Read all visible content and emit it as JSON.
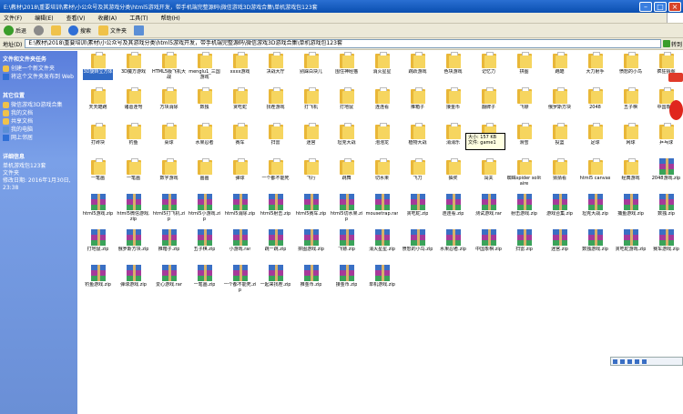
{
  "window": {
    "title": "E:\\教材\\2018\\重要培训\\素材\\小公众号及其游戏分类\\html5游戏开发，带手机端完整源码\\微信游戏3D游戏合集\\单机游戏包123套"
  },
  "menu": [
    "文件(F)",
    "编辑(E)",
    "查看(V)",
    "收藏(A)",
    "工具(T)",
    "帮助(H)"
  ],
  "toolbar": {
    "back": "后退",
    "forward": "",
    "search": "搜索",
    "folders": "文件夹",
    "views": ""
  },
  "address": {
    "label": "地址(D)",
    "value": "E:\\教材\\2018\\重要培训\\素材\\小公众号及其游戏分类\\html5游戏开发，带手机端完整源码\\微信游戏3D游戏合集\\单机游戏包123套",
    "go": "转到"
  },
  "leftpanel": {
    "tasks_title": "文件和文件夹任务",
    "tasks": [
      "创建一个新文件夹",
      "将这个文件夹发布到 Web"
    ],
    "places_title": "其它位置",
    "places": [
      "微信游戏3D游戏合集",
      "我的文档",
      "共享文档",
      "我的电脑",
      "网上邻居"
    ],
    "details_title": "详细信息",
    "details_name": "单机游戏包123套",
    "details_type": "文件夹",
    "details_date": "修改日期: 2016年1月30日, 23:38"
  },
  "tooltip": {
    "size": "大小: 157 KB",
    "files": "文件: game1"
  },
  "items": [
    {
      "type": "folder",
      "label": "3D旋转立方体"
    },
    {
      "type": "folder",
      "label": "3D魔方游戏"
    },
    {
      "type": "folder",
      "label": "HTML5版飞机大战"
    },
    {
      "type": "folder",
      "label": "menglu1_三国游戏"
    },
    {
      "type": "folder",
      "label": "xxxx游戏"
    },
    {
      "type": "folder",
      "label": "决战大厅"
    },
    {
      "type": "folder",
      "label": "别踩白块儿"
    },
    {
      "type": "folder",
      "label": "围住神经猫"
    },
    {
      "type": "folder",
      "label": "消灭星星"
    },
    {
      "type": "folder",
      "label": "跳跃游戏"
    },
    {
      "type": "folder",
      "label": "色块游戏"
    },
    {
      "type": "folder",
      "label": "记忆力"
    },
    {
      "type": "folder",
      "label": "拼图"
    },
    {
      "type": "folder",
      "label": "跑酷"
    },
    {
      "type": "folder",
      "label": "大力射手"
    },
    {
      "type": "folder",
      "label": "愤怒的小鸟"
    },
    {
      "type": "folder",
      "label": "疯狂猜图"
    },
    {
      "type": "folder",
      "label": "天天酷跑"
    },
    {
      "type": "folder",
      "label": "诸葛连弩"
    },
    {
      "type": "folder",
      "label": "方块消除"
    },
    {
      "type": "folder",
      "label": "数独"
    },
    {
      "type": "folder",
      "label": "贪吃蛇"
    },
    {
      "type": "folder",
      "label": "找茬游戏"
    },
    {
      "type": "folder",
      "label": "打飞机"
    },
    {
      "type": "folder",
      "label": "打地鼠"
    },
    {
      "type": "folder",
      "label": "连连看"
    },
    {
      "type": "folder",
      "label": "推箱子"
    },
    {
      "type": "folder",
      "label": "接金币"
    },
    {
      "type": "folder",
      "label": "翻牌子"
    },
    {
      "type": "folder",
      "label": "飞镖"
    },
    {
      "type": "folder",
      "label": "俄罗斯方块"
    },
    {
      "type": "folder",
      "label": "2048"
    },
    {
      "type": "folder",
      "label": "五子棋"
    },
    {
      "type": "folder",
      "label": "中国象棋"
    },
    {
      "type": "folder",
      "label": "打砖块"
    },
    {
      "type": "folder",
      "label": "钓鱼"
    },
    {
      "type": "folder",
      "label": "桌球"
    },
    {
      "type": "folder",
      "label": "水果忍者"
    },
    {
      "type": "folder",
      "label": "赛车"
    },
    {
      "type": "folder",
      "label": "扫雷"
    },
    {
      "type": "folder",
      "label": "迷宫"
    },
    {
      "type": "folder",
      "label": "坦克大战"
    },
    {
      "type": "folder",
      "label": "泡泡龙"
    },
    {
      "type": "folder",
      "label": "植物大战"
    },
    {
      "type": "folder",
      "label": "消消乐"
    },
    {
      "type": "folder",
      "label": "射击"
    },
    {
      "type": "folder",
      "label": "滑雪"
    },
    {
      "type": "folder",
      "label": "投篮"
    },
    {
      "type": "folder",
      "label": "足球"
    },
    {
      "type": "folder",
      "label": "网球"
    },
    {
      "type": "folder",
      "label": "乒乓球"
    },
    {
      "type": "folder",
      "label": "一笔画"
    },
    {
      "type": "folder",
      "label": "一笔画"
    },
    {
      "type": "folder",
      "label": "数字游戏"
    },
    {
      "type": "folder",
      "label": "画画"
    },
    {
      "type": "folder",
      "label": "弹球"
    },
    {
      "type": "folder",
      "label": "一个都不能死"
    },
    {
      "type": "folder",
      "label": "飞行"
    },
    {
      "type": "folder",
      "label": "跳舞"
    },
    {
      "type": "folder",
      "label": "切水果"
    },
    {
      "type": "folder",
      "label": "飞刀"
    },
    {
      "type": "folder",
      "label": "抽奖"
    },
    {
      "type": "folder",
      "label": "闯关"
    },
    {
      "type": "folder",
      "label": "蜘蛛spider solitaire"
    },
    {
      "type": "folder",
      "label": "猜猜看"
    },
    {
      "type": "folder",
      "label": "html5 canvas"
    },
    {
      "type": "folder",
      "label": "经典游戏"
    },
    {
      "type": "zip",
      "label": "2048游戏.zip"
    },
    {
      "type": "zip",
      "label": "html5游戏.zip"
    },
    {
      "type": "zip",
      "label": "html5微信游戏.zip"
    },
    {
      "type": "zip",
      "label": "html5打飞机.zip"
    },
    {
      "type": "zip",
      "label": "html5小游戏.zip"
    },
    {
      "type": "zip",
      "label": "html5消除.zip"
    },
    {
      "type": "zip",
      "label": "html5射击.zip"
    },
    {
      "type": "zip",
      "label": "html5赛车.zip"
    },
    {
      "type": "zip",
      "label": "html5切水果.zip"
    },
    {
      "type": "zip",
      "label": "mousetrap.rar"
    },
    {
      "type": "zip",
      "label": "贪吃蛇.zip"
    },
    {
      "type": "zip",
      "label": "连连看.zip"
    },
    {
      "type": "zip",
      "label": "测试游戏.rar"
    },
    {
      "type": "zip",
      "label": "射击游戏.zip"
    },
    {
      "type": "zip",
      "label": "游戏合集.zip"
    },
    {
      "type": "zip",
      "label": "坦克大战.zip"
    },
    {
      "type": "zip",
      "label": "捕鱼游戏.zip"
    },
    {
      "type": "zip",
      "label": "数独.zip"
    },
    {
      "type": "zip",
      "label": "打地鼠.zip"
    },
    {
      "type": "zip",
      "label": "俄罗斯方块.zip"
    },
    {
      "type": "zip",
      "label": "推箱子.zip"
    },
    {
      "type": "zip",
      "label": "五子棋.zip"
    },
    {
      "type": "zip",
      "label": "小游戏.rar"
    },
    {
      "type": "zip",
      "label": "跳一跳.zip"
    },
    {
      "type": "zip",
      "label": "拼图游戏.zip"
    },
    {
      "type": "zip",
      "label": "飞镖.zip"
    },
    {
      "type": "zip",
      "label": "消灭星星.zip"
    },
    {
      "type": "zip",
      "label": "愤怒的小鸟.zip"
    },
    {
      "type": "zip",
      "label": "水果忍者.zip"
    },
    {
      "type": "zip",
      "label": "中国象棋.zip"
    },
    {
      "type": "zip",
      "label": "扫雷.zip"
    },
    {
      "type": "zip",
      "label": "迷宫.zip"
    },
    {
      "type": "zip",
      "label": "数独游戏.zip"
    },
    {
      "type": "zip",
      "label": "贪吃蛇游戏.zip"
    },
    {
      "type": "zip",
      "label": "赛车游戏.zip"
    },
    {
      "type": "zip",
      "label": "钓鱼游戏.zip"
    },
    {
      "type": "zip",
      "label": "弹球游戏.zip"
    },
    {
      "type": "zip",
      "label": "爱心游戏.rar"
    },
    {
      "type": "zip",
      "label": "一笔画.zip"
    },
    {
      "type": "zip",
      "label": "一个都不能死.zip"
    },
    {
      "type": "zip",
      "label": "一起来找茬.zip"
    },
    {
      "type": "zip",
      "label": "推金币.zip"
    },
    {
      "type": "zip",
      "label": "接金币.zip"
    },
    {
      "type": "zip",
      "label": "单机游戏.zip"
    }
  ]
}
